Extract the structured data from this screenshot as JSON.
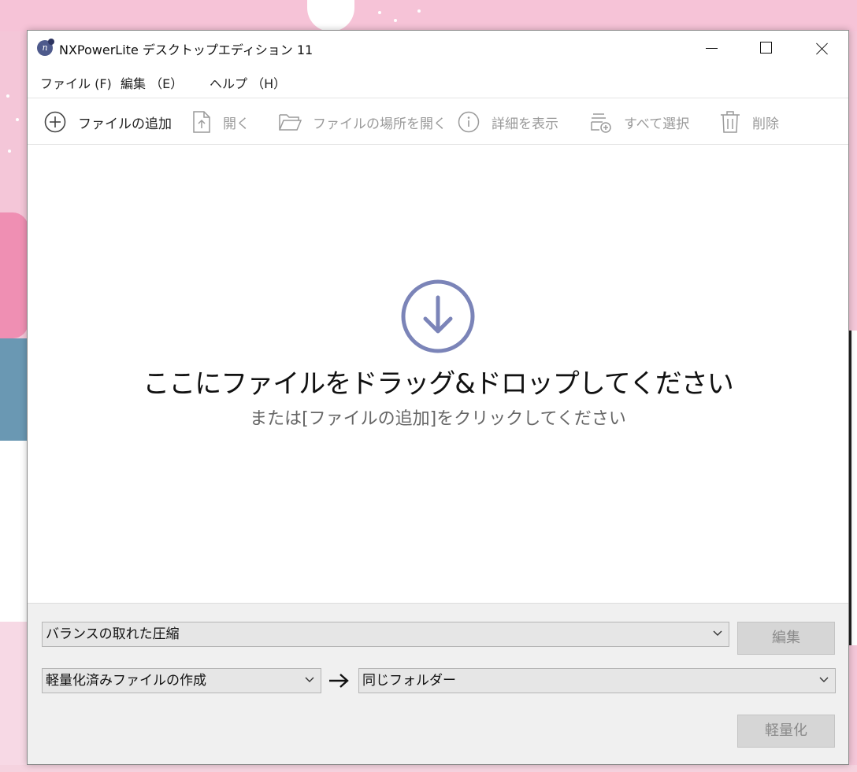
{
  "window": {
    "title": "NXPowerLite デスクトップエディション 11"
  },
  "menu": {
    "file": "ファイル (F)",
    "edit": "編集 （E）",
    "help": "ヘルプ （H）"
  },
  "toolbar": {
    "add_file": "ファイルの追加",
    "open": "開く",
    "open_location": "ファイルの場所を開く",
    "show_details": "詳細を表示",
    "select_all": "すべて選択",
    "delete": "削除"
  },
  "drop": {
    "title": "ここにファイルをドラッグ&ドロップしてください",
    "subtitle": "または[ファイルの追加]をクリックしてください"
  },
  "options": {
    "preset": "バランスの取れた圧縮",
    "edit_button": "編集",
    "action": "軽量化済みファイルの作成",
    "destination": "同じフォルダー",
    "compress_button": "軽量化"
  },
  "colors": {
    "accent": "#7b84b8",
    "disabled_text": "#9a9a9a"
  }
}
